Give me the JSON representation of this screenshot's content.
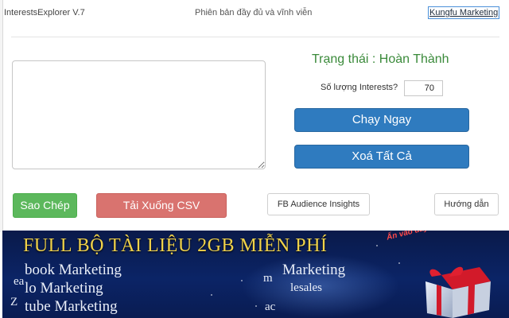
{
  "header": {
    "app_name": "InterestsExplorer V.7",
    "subtitle": "Phiên bản đầy đủ và vĩnh viễn",
    "brand_link": "Kungfu Marketing"
  },
  "main": {
    "textarea_value": "",
    "status_label": "Trạng thái :",
    "status_value": "Hoàn Thành",
    "count_label": "Số lượng Interests?",
    "count_value": "70",
    "run_button": "Chạy Ngay",
    "clear_button": "Xoá Tất Cả"
  },
  "actions": {
    "copy_button": "Sao Chép",
    "download_csv_button": "Tải Xuống CSV",
    "fb_insights_button": "FB Audience Insights",
    "guide_button": "Hướng dẫn"
  },
  "banner": {
    "headline": "FULL BỘ TÀI LIỆU 2GB MIỄN PHÍ",
    "col1": [
      "book Marketing",
      "lo Marketing",
      "tube Marketing"
    ],
    "col2": [
      "Marketing",
      "lesales"
    ],
    "frag_a": "ea",
    "frag_b": "Z",
    "frag_c": "m",
    "frag_d": "ac",
    "promo": "Ấn vào đây để mở quà"
  },
  "colors": {
    "primary_blue": "#2f7bbf",
    "success_green": "#5cb85c",
    "danger_red": "#d9736f",
    "status_green": "#3a8a3a",
    "banner_gold": "#f0d24a",
    "banner_navy": "#0b2466"
  }
}
